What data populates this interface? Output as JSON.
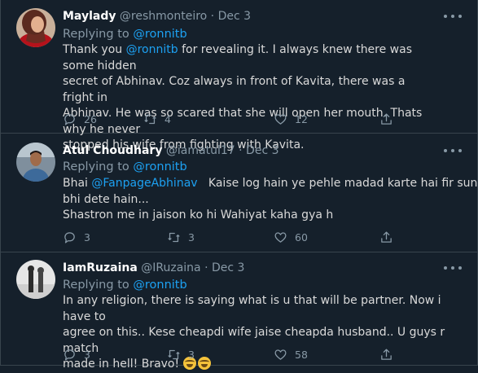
{
  "tweets": [
    {
      "name": "Maylady",
      "handle": "@reshmonteiro",
      "sep": " · ",
      "date": "Dec 3",
      "replying_prefix": "Replying to ",
      "replying_to": "@ronnitb",
      "line1_prefix": "Thank you ",
      "line1_mention": "@ronnitb",
      "line1_rest": " for revealing it. I always knew there was some hidden",
      "line2": "secret of Abhinav. Coz always in front of Kavita, there was a fright in",
      "line3": "Abhinav. He was so scared that she will open her mouth. Thats why he never",
      "line4": "stopped his wife from fighting with Kavita.",
      "replies": "26",
      "retweets": "4",
      "likes": "12"
    },
    {
      "name": "Atul Choudhary",
      "handle": "@iamatul17",
      "sep": " · ",
      "date": "Dec 3",
      "replying_prefix": "Replying to ",
      "replying_to": "@ronnitb",
      "line1_prefix": "Bhai ",
      "line1_mention": "@FanpageAbhinav",
      "line1_rest": "   Kaise log hain ye pehle madad karte hai fir suna",
      "line2": "bhi dete hain...",
      "line3": "Shastron me in jaison ko hi Wahiyat kaha gya h",
      "replies": "3",
      "retweets": "3",
      "likes": "60"
    },
    {
      "name": "IamRuzaina",
      "handle": "@IRuzaina",
      "sep": " · ",
      "date": "Dec 3",
      "replying_prefix": "Replying to ",
      "replying_to": "@ronnitb",
      "line1": "In any religion, there is saying what is u that will be partner.  Now i have to",
      "line2": "agree on this.. Kese cheapdi wife jaise cheapda husband.. U guys r match",
      "line3": "made in hell! Bravo! ",
      "emoji": "face-with-tears-of-joy",
      "replies": "3",
      "retweets": "3",
      "likes": "58"
    }
  ],
  "icons": [
    "reply-icon",
    "retweet-icon",
    "like-icon",
    "share-icon",
    "more-icon"
  ],
  "colors": {
    "background": "#15202b",
    "accent": "#1da1f2",
    "muted": "#8899a6",
    "text": "#d9d9d9",
    "divider": "#38444d"
  }
}
